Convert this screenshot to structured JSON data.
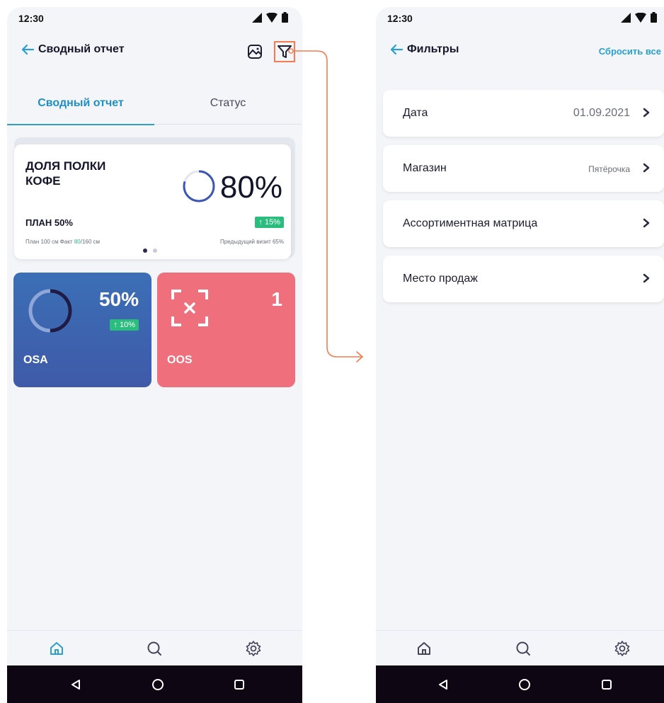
{
  "left_screen": {
    "status_time": "12:30",
    "title": "Сводный отчет",
    "icons": {
      "back": "arrow-left-icon",
      "image": "image-icon",
      "filter": "filter-icon"
    },
    "tabs": [
      {
        "label": "Сводный отчет",
        "active": true
      },
      {
        "label": "Статус",
        "active": false
      }
    ],
    "main_card": {
      "title": "ДОЛЯ ПОЛКИ КОФЕ",
      "percent": "80%",
      "ring_fraction": 0.8,
      "plan": "ПЛАН 50%",
      "change": "↑ 15%",
      "sub_prefix": "План 100 см Факт ",
      "sub_fact": "80",
      "sub_suffix": "/160 см",
      "previous": "Предыдущий визит 65%",
      "page_dots": 2,
      "active_dot": 0
    },
    "tiles": [
      {
        "label": "OSA",
        "value": "50%",
        "change": "↑ 10%",
        "ring_fraction": 0.5
      },
      {
        "label": "OOS",
        "value": "1",
        "icon": "scan-x-icon"
      }
    ],
    "bottom_nav": [
      "home-icon",
      "search-icon",
      "settings-icon"
    ],
    "active_nav": "home-icon"
  },
  "right_screen": {
    "status_time": "12:30",
    "title": "Фильтры",
    "reset_label": "Сбросить все",
    "filters": [
      {
        "label": "Дата",
        "value": "01.09.2021"
      },
      {
        "label": "Магазин",
        "value": "Пятёрочка"
      },
      {
        "label": "Ассортиментная матрица",
        "value": ""
      },
      {
        "label": "Место продаж",
        "value": ""
      }
    ],
    "bottom_nav": [
      "home-icon",
      "search-icon",
      "settings-icon"
    ]
  },
  "colors": {
    "accent": "#2a9fd0",
    "badge_green": "#2bbd7e",
    "osa_tile": "#3f5aa8",
    "oos_tile": "#ef6f7d",
    "highlight": "#f57b52",
    "android_bar": "#0f0614",
    "background": "#f4f5f9"
  }
}
